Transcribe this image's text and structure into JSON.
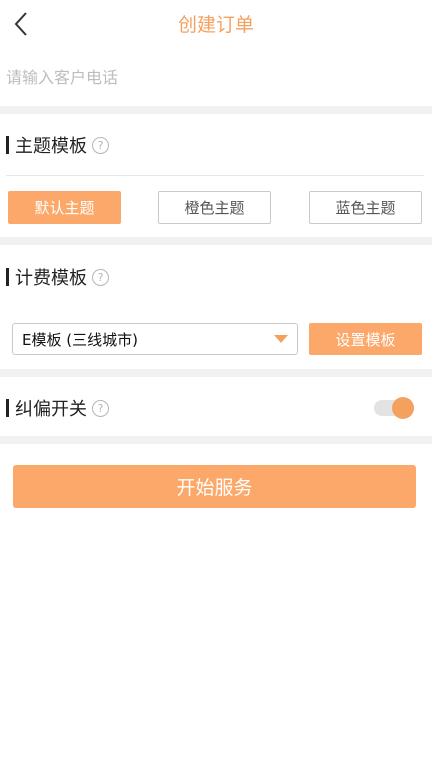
{
  "header": {
    "title": "创建订单",
    "back_icon": "chevron-left-icon"
  },
  "phone": {
    "placeholder": "请输入客户电话",
    "value": ""
  },
  "theme_section": {
    "title": "主题模板",
    "help_icon": "question-circle-icon",
    "options": [
      {
        "label": "默认主题",
        "selected": true
      },
      {
        "label": "橙色主题",
        "selected": false
      },
      {
        "label": "蓝色主题",
        "selected": false
      }
    ]
  },
  "billing_section": {
    "title": "计费模板",
    "help_icon": "question-circle-icon",
    "selected_template": "E模板 (三线城市)",
    "set_button": "设置模板"
  },
  "correction_section": {
    "title": "纠偏开关",
    "help_icon": "question-circle-icon",
    "toggle_on": true
  },
  "start_button": "开始服务",
  "colors": {
    "accent": "#f5a15e",
    "button": "#fca86a",
    "separator": "#f1f1f1"
  }
}
